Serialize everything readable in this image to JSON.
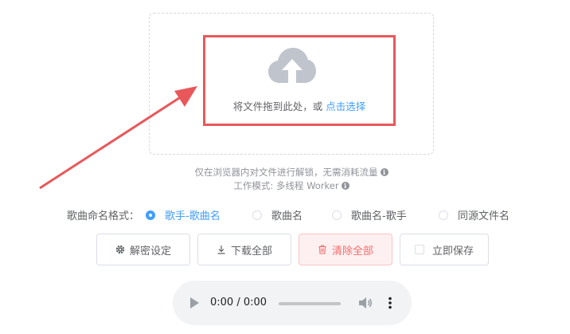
{
  "upload": {
    "drop_text": "将文件拖到此处，或",
    "select_link": "点击选择"
  },
  "notes": {
    "line1": "仅在浏览器内对文件进行解锁，无需消耗流量",
    "line2": "工作模式: 多线程 Worker",
    "info_icon": "i"
  },
  "naming": {
    "title": "歌曲命名格式：",
    "options": [
      {
        "label": "歌手-歌曲名",
        "checked": true
      },
      {
        "label": "歌曲名",
        "checked": false
      },
      {
        "label": "歌曲名-歌手",
        "checked": false
      },
      {
        "label": "同源文件名",
        "checked": false
      }
    ]
  },
  "buttons": {
    "decrypt_settings": "解密设定",
    "download_all": "下载全部",
    "clear_all": "清除全部",
    "save_now": "立即保存"
  },
  "player": {
    "time": "0:00 / 0:00"
  },
  "colors": {
    "accent": "#409eff",
    "highlight_red": "#e8585b",
    "danger": "#f56c6c"
  }
}
